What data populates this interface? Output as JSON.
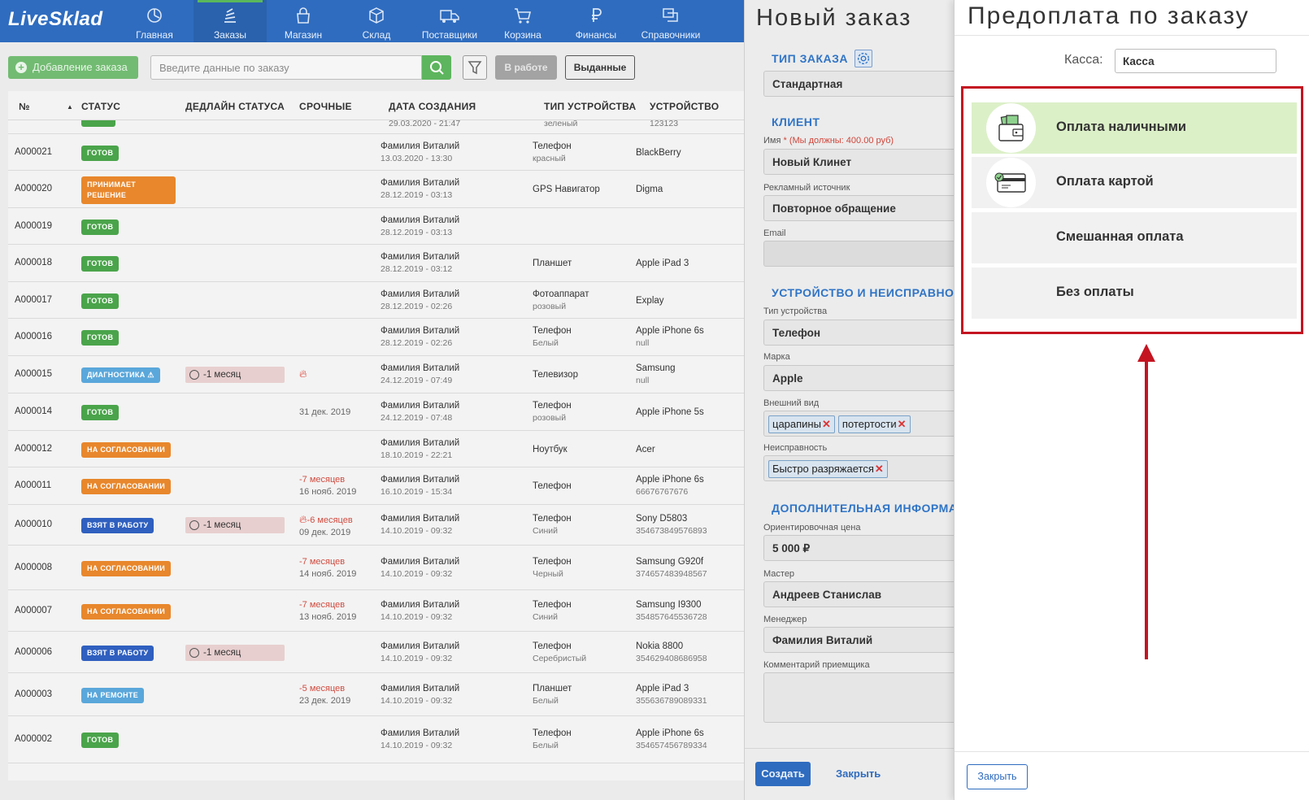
{
  "app": {
    "logo": "LiveSklad"
  },
  "nav": {
    "items": [
      {
        "label": "Главная",
        "icon": "dashboard-icon"
      },
      {
        "label": "Заказы",
        "icon": "orders-icon",
        "active": true
      },
      {
        "label": "Магазин",
        "icon": "store-icon"
      },
      {
        "label": "Склад",
        "icon": "box-icon"
      },
      {
        "label": "Поставщики",
        "icon": "truck-icon"
      },
      {
        "label": "Корзина",
        "icon": "cart-icon"
      },
      {
        "label": "Финансы",
        "icon": "ruble-icon"
      },
      {
        "label": "Справочники",
        "icon": "reference-icon"
      }
    ]
  },
  "toolbar": {
    "add_label": "Добавление заказа",
    "search_placeholder": "Введите данные по заказу",
    "in_work_label": "В работе",
    "issued_label": "Выданные"
  },
  "table": {
    "headers": {
      "num": "№",
      "status": "СТАТУС",
      "deadline": "ДЕДЛАЙН СТАТУСА",
      "urgent": "СРОЧНЫЕ",
      "created": "ДАТА СОЗДАНИЯ",
      "device_type": "ТИП УСТРОЙСТВА",
      "device": "УСТРОЙСТВО"
    },
    "partial_row": {
      "created": "29.03.2020 - 21:47",
      "type_sub": "зеленый",
      "device_sub": "123123"
    },
    "rows": [
      {
        "num": "A000021",
        "status": "ГОТОВ",
        "status_color": "#4aa44a",
        "creator": "Фамилия Виталий",
        "date": "13.03.2020 - 13:30",
        "type": "Телефон",
        "type_sub": "красный",
        "device": "BlackBerry",
        "device_sub": ""
      },
      {
        "num": "A000020",
        "status": "ПРИНИМАЕТ РЕШЕНИЕ",
        "status_color": "#e8872c",
        "creator": "Фамилия Виталий",
        "date": "28.12.2019 - 03:13",
        "type": "GPS Навигатор",
        "type_sub": "",
        "device": "Digma",
        "device_sub": ""
      },
      {
        "num": "A000019",
        "status": "ГОТОВ",
        "status_color": "#4aa44a",
        "creator": "Фамилия Виталий",
        "date": "28.12.2019 - 03:13",
        "type": "",
        "type_sub": "",
        "device": "",
        "device_sub": ""
      },
      {
        "num": "A000018",
        "status": "ГОТОВ",
        "status_color": "#4aa44a",
        "creator": "Фамилия Виталий",
        "date": "28.12.2019 - 03:12",
        "type": "Планшет",
        "type_sub": "",
        "device": "Apple iPad 3",
        "device_sub": ""
      },
      {
        "num": "A000017",
        "status": "ГОТОВ",
        "status_color": "#4aa44a",
        "creator": "Фамилия Виталий",
        "date": "28.12.2019 - 02:26",
        "type": "Фотоаппарат",
        "type_sub": "розовый",
        "device": "Explay",
        "device_sub": ""
      },
      {
        "num": "A000016",
        "status": "ГОТОВ",
        "status_color": "#4aa44a",
        "creator": "Фамилия Виталий",
        "date": "28.12.2019 - 02:26",
        "type": "Телефон",
        "type_sub": "Белый",
        "device": "Apple iPhone 6s",
        "device_sub": "null"
      },
      {
        "num": "A000015",
        "status": "ДИАГНОСТИКА ⚠",
        "status_color": "#5aa7db",
        "deadline": "-1 месяц",
        "urgent_flame": true,
        "creator": "Фамилия Виталий",
        "date": "24.12.2019 - 07:49",
        "type": "Телевизор",
        "type_sub": "",
        "device": "Samsung",
        "device_sub": "null"
      },
      {
        "num": "A000014",
        "status": "ГОТОВ",
        "status_color": "#4aa44a",
        "urgent_date": "31 дек. 2019",
        "creator": "Фамилия Виталий",
        "date": "24.12.2019 - 07:48",
        "type": "Телефон",
        "type_sub": "розовый",
        "device": "Apple iPhone 5s",
        "device_sub": ""
      },
      {
        "num": "A000012",
        "status": "НА СОГЛАСОВАНИИ",
        "status_color": "#e8872c",
        "creator": "Фамилия Виталий",
        "date": "18.10.2019 - 22:21",
        "type": "Ноутбук",
        "type_sub": "",
        "device": "Acer",
        "device_sub": ""
      },
      {
        "num": "A000011",
        "status": "НА СОГЛАСОВАНИИ",
        "status_color": "#e8872c",
        "urgent_red": "-7 месяцев",
        "urgent_date": "16 нояб. 2019",
        "creator": "Фамилия Виталий",
        "date": "16.10.2019 - 15:34",
        "type": "Телефон",
        "type_sub": "",
        "device": "Apple iPhone 6s",
        "device_sub": "66676767676"
      },
      {
        "num": "A000010",
        "status": "ВЗЯТ В РАБОТУ",
        "status_color": "#2f5fbf",
        "deadline": "-1 месяц",
        "urgent_flame": true,
        "urgent_red": "-6 месяцев",
        "urgent_date": "09 дек. 2019",
        "creator": "Фамилия Виталий",
        "date": "14.10.2019 - 09:32",
        "type": "Телефон",
        "type_sub": "Синий",
        "device": "Sony D5803",
        "device_sub": "354673849576893"
      },
      {
        "num": "A000008",
        "status": "НА СОГЛАСОВАНИИ",
        "status_color": "#e8872c",
        "urgent_red": "-7 месяцев",
        "urgent_date": "14 нояб. 2019",
        "creator": "Фамилия Виталий",
        "date": "14.10.2019 - 09:32",
        "type": "Телефон",
        "type_sub": "Черный",
        "device": "Samsung G920f",
        "device_sub": "374657483948567"
      },
      {
        "num": "A000007",
        "status": "НА СОГЛАСОВАНИИ",
        "status_color": "#e8872c",
        "urgent_red": "-7 месяцев",
        "urgent_date": "13 нояб. 2019",
        "creator": "Фамилия Виталий",
        "date": "14.10.2019 - 09:32",
        "type": "Телефон",
        "type_sub": "Синий",
        "device": "Samsung I9300",
        "device_sub": "354857645536728"
      },
      {
        "num": "A000006",
        "status": "ВЗЯТ В РАБОТУ",
        "status_color": "#2f5fbf",
        "deadline": "-1 месяц",
        "creator": "Фамилия Виталий",
        "date": "14.10.2019 - 09:32",
        "type": "Телефон",
        "type_sub": "Серебристый",
        "device": "Nokia 8800",
        "device_sub": "354629408686958"
      },
      {
        "num": "A000003",
        "status": "НА РЕМОНТЕ",
        "status_color": "#5aa7db",
        "urgent_red": "-5 месяцев",
        "urgent_date": "23 дек. 2019",
        "creator": "Фамилия Виталий",
        "date": "14.10.2019 - 09:32",
        "type": "Планшет",
        "type_sub": "Белый",
        "device": "Apple iPad 3",
        "device_sub": "355636789089331"
      },
      {
        "num": "A000002",
        "status": "ГОТОВ",
        "status_color": "#4aa44a",
        "creator": "Фамилия Виталий",
        "date": "14.10.2019 - 09:32",
        "type": "Телефон",
        "type_sub": "Белый",
        "device": "Apple iPhone 6s",
        "device_sub": "354657456789334"
      }
    ]
  },
  "order_panel": {
    "title": "Новый заказ",
    "order_type_title": "ТИП ЗАКАЗА",
    "order_type_value": "Стандартная",
    "client_title": "КЛИЕНТ",
    "name_label": "Имя",
    "name_req": "* (Мы должны: 400.00 руб)",
    "name_value": "Новый Клинет",
    "source_label": "Рекламный источник",
    "source_value": "Повторное обращение",
    "email_label": "Email",
    "device_title": "УСТРОЙСТВО И НЕИСПРАВНО",
    "device_type_label": "Тип устройства",
    "device_type_value": "Телефон",
    "brand_label": "Марка",
    "brand_value": "Apple",
    "appearance_label": "Внешний вид",
    "appearance_tags": [
      "царапины",
      "потертости"
    ],
    "fault_label": "Неисправность",
    "fault_tags": [
      "Быстро разряжается"
    ],
    "extra_title": "ДОПОЛНИТЕЛЬНАЯ ИНФОРМА",
    "price_label": "Ориентировочная цена",
    "price_value": "5 000 ₽",
    "master_label": "Мастер",
    "master_value": "Андреев Станислав",
    "manager_label": "Менеджер",
    "manager_value": "Фамилия Виталий",
    "comment_label": "Комментарий приемщика",
    "create_label": "Создать",
    "close_label": "Закрыть"
  },
  "prepay": {
    "title": "Предоплата по заказу",
    "kassa_label": "Касса:",
    "kassa_value": "Касса",
    "options": [
      {
        "label": "Оплата наличными",
        "icon": "wallet-cash-icon",
        "selected": true
      },
      {
        "label": "Оплата картой",
        "icon": "credit-card-icon",
        "selected": false
      },
      {
        "label": "Смешанная оплата",
        "icon": "",
        "selected": false
      },
      {
        "label": "Без оплаты",
        "icon": "",
        "selected": false
      }
    ],
    "close_label": "Закрыть",
    "highlight_color": "#c41421"
  }
}
